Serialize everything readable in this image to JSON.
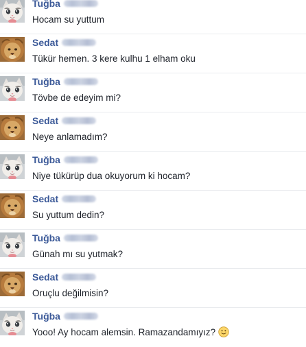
{
  "messages": [
    {
      "sender": "Tuğba",
      "avatar": "kitten",
      "text": "Hocam su yuttum"
    },
    {
      "sender": "Sedat",
      "avatar": "lion",
      "text": "Tükür hemen. 3 kere kulhu 1 elham oku"
    },
    {
      "sender": "Tuğba",
      "avatar": "kitten",
      "text": "Tövbe de edeyim mi?"
    },
    {
      "sender": "Sedat",
      "avatar": "lion",
      "text": "Neye anlamadım?"
    },
    {
      "sender": "Tuğba",
      "avatar": "kitten",
      "text": "Niye tükürüp dua okuyorum ki hocam?"
    },
    {
      "sender": "Sedat",
      "avatar": "lion",
      "text": "Su yuttum dedin?"
    },
    {
      "sender": "Tuğba",
      "avatar": "kitten",
      "text": "Günah mı su yutmak?"
    },
    {
      "sender": "Sedat",
      "avatar": "lion",
      "text": "Oruçlu değilmisin?"
    },
    {
      "sender": "Tuğba",
      "avatar": "kitten",
      "text": "Yooo! Ay hocam alemsin. Ramazandamıyız?",
      "emoji": "smiley-icon"
    }
  ],
  "colors": {
    "sender_name": "#3b5998",
    "message_text": "#1d2129",
    "divider": "#e9ebee"
  }
}
